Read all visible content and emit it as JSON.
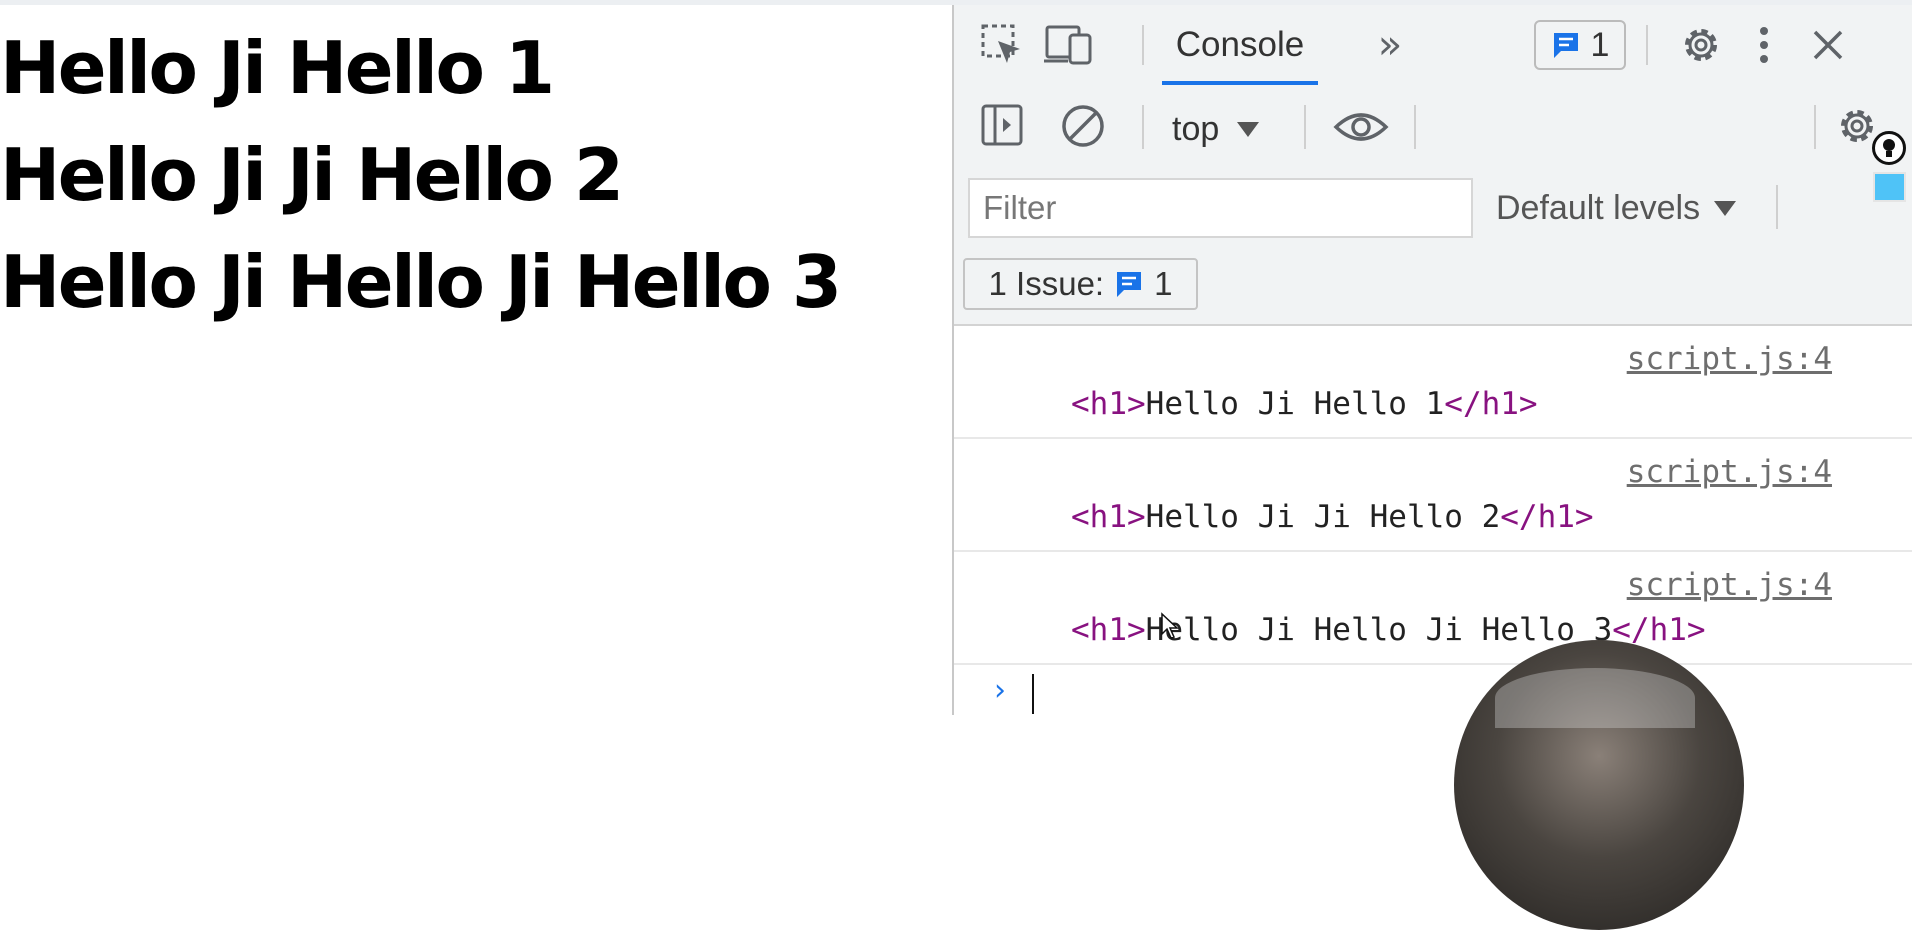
{
  "page": {
    "headings": [
      "Hello Ji Hello 1",
      "Hello Ji Ji Hello 2",
      "Hello Ji Hello Ji Hello 3"
    ]
  },
  "devtools": {
    "toolbar": {
      "inspect_icon": "element-picker-icon",
      "device_icon": "device-toolbar-icon",
      "active_tab": "Console",
      "more_tabs_glyph": "»",
      "issues_badge_count": "1",
      "settings_icon": "gear-icon",
      "menu_icon": "kebab-menu-icon",
      "close_icon": "close-icon"
    },
    "console_toolbar": {
      "context": "top",
      "filter_placeholder": "Filter",
      "levels_label": "Default levels"
    },
    "issues_bar": {
      "label": "1 Issue:",
      "count": "1"
    },
    "messages": [
      {
        "source": "script.js:4",
        "open_tag": "<h1>",
        "text": "Hello Ji Hello 1",
        "close_tag": "</h1>"
      },
      {
        "source": "script.js:4",
        "open_tag": "<h1>",
        "text": "Hello Ji Ji Hello 2",
        "close_tag": "</h1>"
      },
      {
        "source": "script.js:4",
        "open_tag": "<h1>",
        "text": "Hello Ji Hello Ji Hello 3",
        "close_tag": "</h1>"
      }
    ],
    "prompt_glyph": "›"
  },
  "colors": {
    "tab_underline": "#1a73e8",
    "tag_color": "#881280",
    "toolbar_bg": "#f1f3f4"
  }
}
